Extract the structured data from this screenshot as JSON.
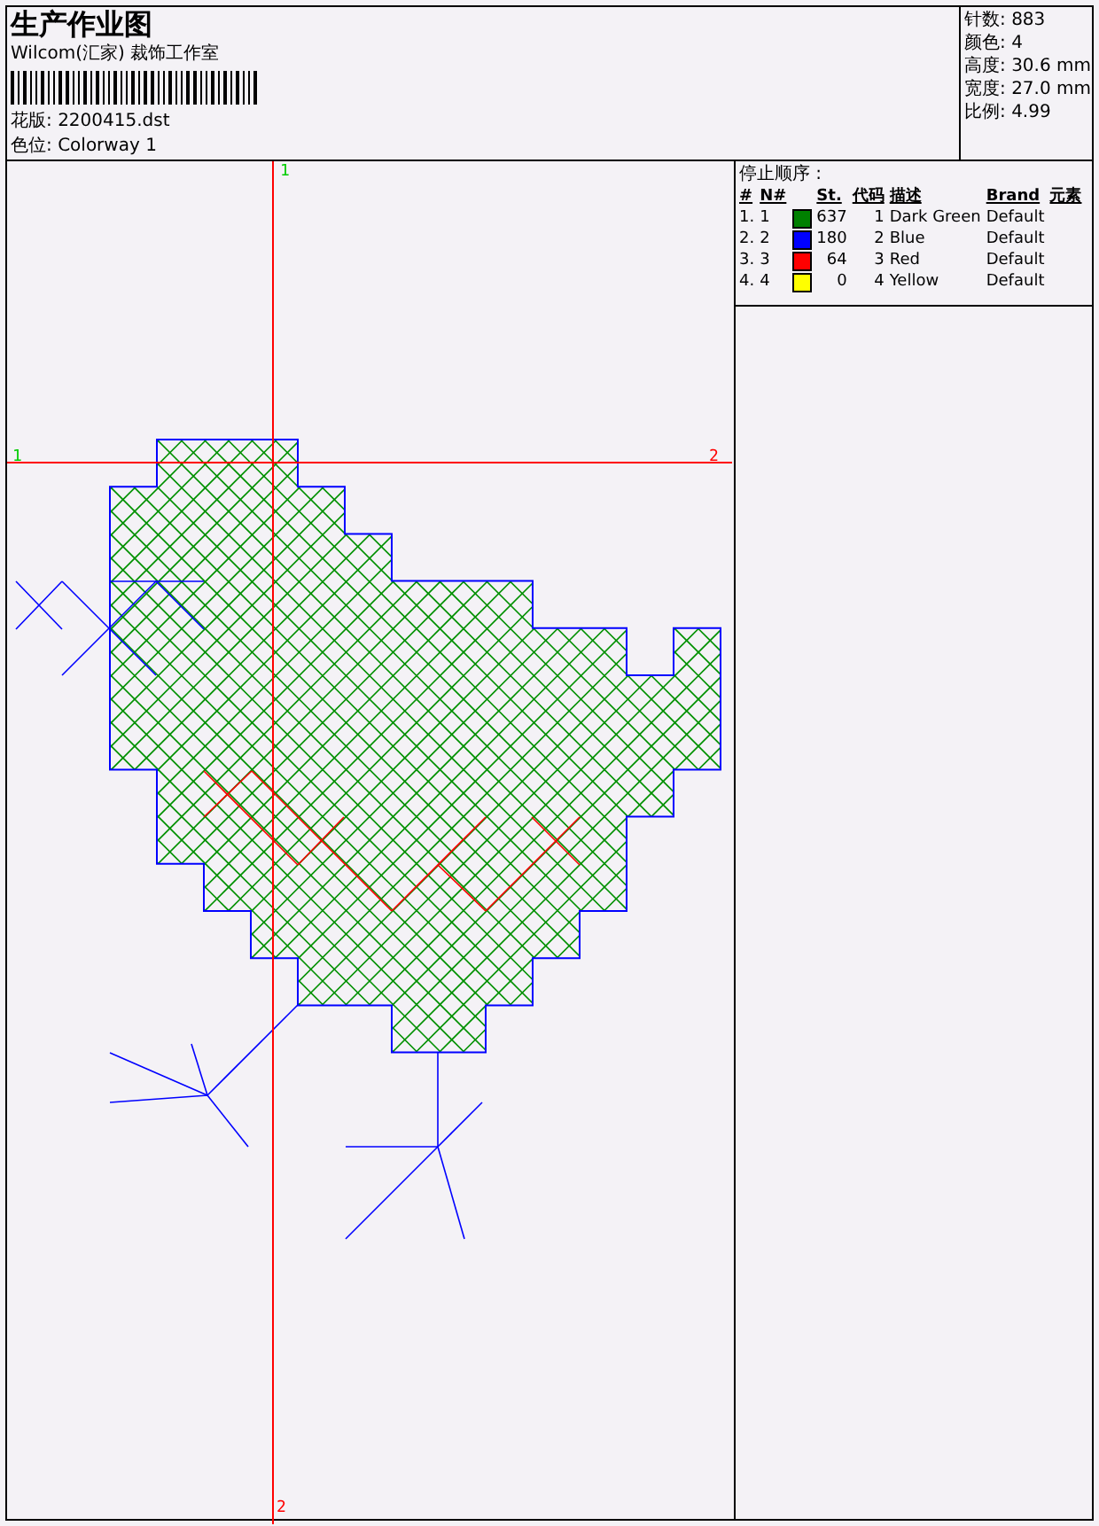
{
  "header": {
    "title": "生产作业图",
    "company": "Wilcom(汇家) 裁饰工作室",
    "fields": [
      {
        "label": "花版:",
        "value": "2200415.dst"
      },
      {
        "label": "色位:",
        "value": "Colorway 1"
      }
    ]
  },
  "info": [
    {
      "label": "针数:",
      "value": "883"
    },
    {
      "label": "颜色:",
      "value": "4"
    },
    {
      "label": "高度:",
      "value": "30.6 mm"
    },
    {
      "label": "宽度:",
      "value": "27.0 mm"
    },
    {
      "label": "比例:",
      "value": "4.99"
    }
  ],
  "stop_sequence": {
    "title": "停止顺序 :",
    "columns": [
      "#",
      "N#",
      "St.",
      "代码",
      "描述",
      "Brand",
      "元素"
    ],
    "rows": [
      {
        "index": "1.",
        "number": "1",
        "color": "#008000",
        "stitches": "637",
        "code": "1",
        "description": "Dark Green",
        "brand": "Default"
      },
      {
        "index": "2.",
        "number": "2",
        "color": "#0000ff",
        "stitches": "180",
        "code": "2",
        "description": "Blue",
        "brand": "Default"
      },
      {
        "index": "3.",
        "number": "3",
        "color": "#ff0000",
        "stitches": "64",
        "code": "3",
        "description": "Red",
        "brand": "Default"
      },
      {
        "index": "4.",
        "number": "4",
        "color": "#ffff00",
        "stitches": "0",
        "code": "4",
        "description": "Yellow",
        "brand": "Default"
      }
    ]
  },
  "canvas": {
    "markers": [
      {
        "label": "1",
        "kind": "top",
        "color": "#00cc00"
      },
      {
        "label": "1",
        "kind": "left",
        "color": "#00cc00"
      },
      {
        "label": "2",
        "kind": "right",
        "color": "#ff0000"
      },
      {
        "label": "2",
        "kind": "bottom",
        "color": "#ff0000"
      }
    ]
  }
}
